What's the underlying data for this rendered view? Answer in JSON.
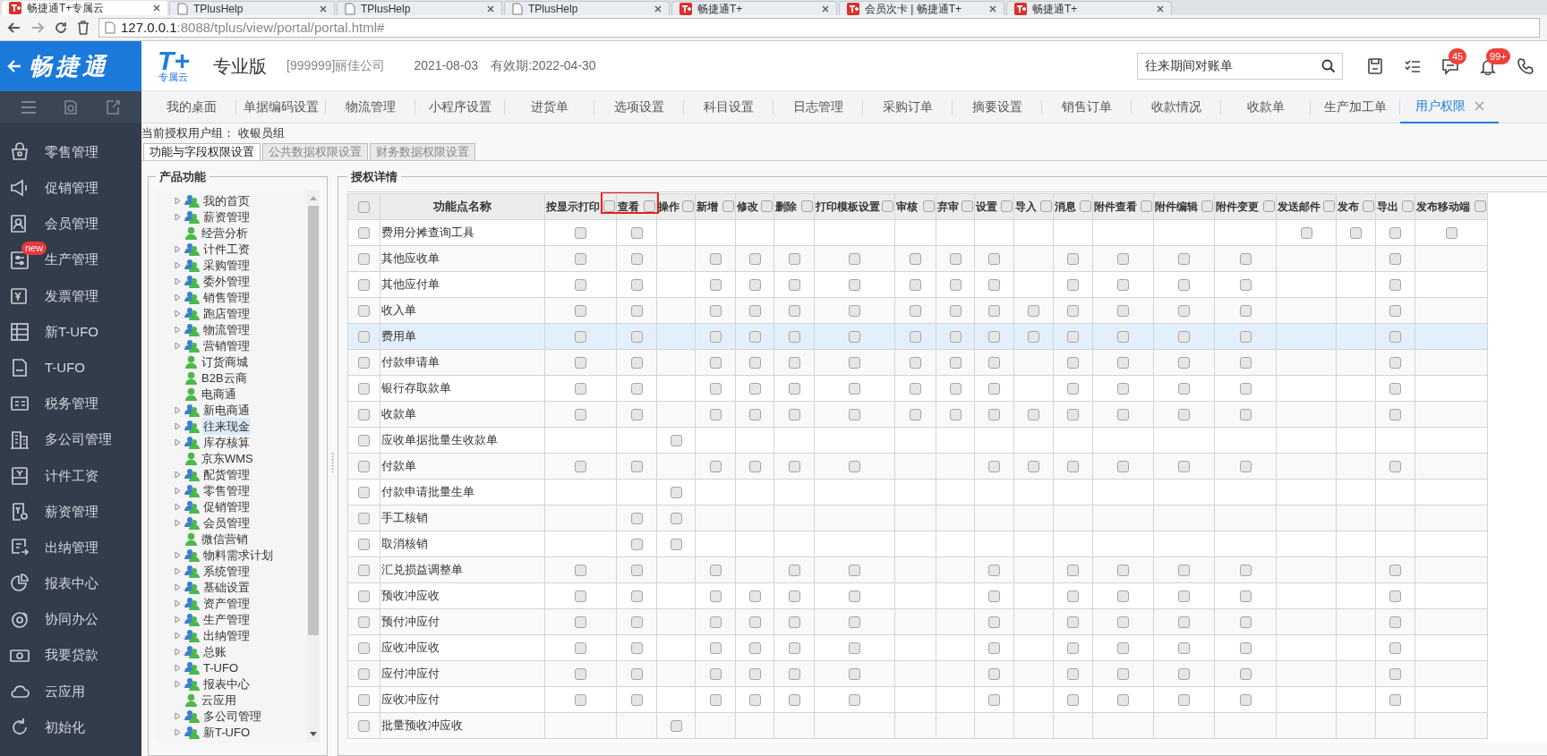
{
  "browser": {
    "tabs": [
      {
        "title": "畅捷通T+专属云",
        "kind": "app",
        "selected": true
      },
      {
        "title": "TPlusHelp",
        "kind": "doc",
        "selected": false
      },
      {
        "title": "TPlusHelp",
        "kind": "doc",
        "selected": false
      },
      {
        "title": "TPlusHelp",
        "kind": "doc",
        "selected": false
      },
      {
        "title": "畅捷通T+",
        "kind": "app",
        "selected": false
      },
      {
        "title": "会员次卡 | 畅捷通T+",
        "kind": "app",
        "selected": false
      },
      {
        "title": "畅捷通T+",
        "kind": "app",
        "selected": false
      }
    ],
    "address": {
      "host": "127.0.0.1",
      "path": ":8088/tplus/view/portal/portal.html#"
    }
  },
  "header": {
    "brand": "畅捷通",
    "logo": {
      "mark": "T+",
      "sub": "专属云"
    },
    "edition": "专业版",
    "company": "[999999]丽佳公司",
    "date": "2021-08-03",
    "validity": "有效期:2022-04-30",
    "search": {
      "value": "往来期间对账单"
    },
    "actions": [
      {
        "kind": "save"
      },
      {
        "kind": "checklist"
      },
      {
        "kind": "message",
        "badge": "45"
      },
      {
        "kind": "bell",
        "badge": "99+"
      },
      {
        "kind": "phone"
      }
    ]
  },
  "sidebar": {
    "items": [
      {
        "label": "零售管理"
      },
      {
        "label": "促销管理"
      },
      {
        "label": "会员管理"
      },
      {
        "label": "生产管理",
        "badge": "new"
      },
      {
        "label": "发票管理"
      },
      {
        "label": "新T-UFO"
      },
      {
        "label": "T-UFO"
      },
      {
        "label": "税务管理"
      },
      {
        "label": "多公司管理"
      },
      {
        "label": "计件工资"
      },
      {
        "label": "薪资管理"
      },
      {
        "label": "出纳管理"
      },
      {
        "label": "报表中心"
      },
      {
        "label": "协同办公"
      },
      {
        "label": "我要贷款"
      },
      {
        "label": "云应用"
      },
      {
        "label": "初始化"
      }
    ]
  },
  "nav_tabs": [
    {
      "label": "我的桌面",
      "selected": false
    },
    {
      "label": "单据编码设置",
      "selected": false
    },
    {
      "label": "物流管理",
      "selected": false
    },
    {
      "label": "小程序设置",
      "selected": false
    },
    {
      "label": "进货单",
      "selected": false
    },
    {
      "label": "选项设置",
      "selected": false
    },
    {
      "label": "科目设置",
      "selected": false
    },
    {
      "label": "日志管理",
      "selected": false
    },
    {
      "label": "采购订单",
      "selected": false
    },
    {
      "label": "摘要设置",
      "selected": false
    },
    {
      "label": "销售订单",
      "selected": false
    },
    {
      "label": "收款情况",
      "selected": false
    },
    {
      "label": "收款单",
      "selected": false
    },
    {
      "label": "生产加工单",
      "selected": false
    },
    {
      "label": "用户权限",
      "selected": true
    }
  ],
  "user_group": {
    "label": "当前授权用户组：",
    "value": "收银员组"
  },
  "sub_tabs": [
    {
      "label": "功能与字段权限设置",
      "selected": true
    },
    {
      "label": "公共数据权限设置",
      "selected": false
    },
    {
      "label": "财务数据权限设置",
      "selected": false
    }
  ],
  "product_panel": {
    "title": "产品功能",
    "tree": [
      {
        "label": "我的首页",
        "kind": "group",
        "selected": false
      },
      {
        "label": "薪资管理",
        "kind": "group",
        "selected": false
      },
      {
        "label": "经营分析",
        "kind": "leaf",
        "selected": false
      },
      {
        "label": "计件工资",
        "kind": "group",
        "selected": false
      },
      {
        "label": "采购管理",
        "kind": "group",
        "selected": false
      },
      {
        "label": "委外管理",
        "kind": "group",
        "selected": false
      },
      {
        "label": "销售管理",
        "kind": "group",
        "selected": false
      },
      {
        "label": "跑店管理",
        "kind": "group",
        "selected": false
      },
      {
        "label": "物流管理",
        "kind": "group",
        "selected": false
      },
      {
        "label": "营销管理",
        "kind": "group",
        "selected": false
      },
      {
        "label": "订货商城",
        "kind": "leaf",
        "selected": false
      },
      {
        "label": "B2B云商",
        "kind": "leaf",
        "selected": false
      },
      {
        "label": "电商通",
        "kind": "leaf",
        "selected": false
      },
      {
        "label": "新电商通",
        "kind": "group",
        "selected": false
      },
      {
        "label": "往来现金",
        "kind": "group",
        "selected": true
      },
      {
        "label": "库存核算",
        "kind": "group",
        "selected": false
      },
      {
        "label": "京东WMS",
        "kind": "leaf",
        "selected": false
      },
      {
        "label": "配货管理",
        "kind": "group",
        "selected": false
      },
      {
        "label": "零售管理",
        "kind": "group",
        "selected": false
      },
      {
        "label": "促销管理",
        "kind": "group",
        "selected": false
      },
      {
        "label": "会员管理",
        "kind": "group",
        "selected": false
      },
      {
        "label": "微信营销",
        "kind": "leaf",
        "selected": false
      },
      {
        "label": "物料需求计划",
        "kind": "group",
        "selected": false
      },
      {
        "label": "系统管理",
        "kind": "group",
        "selected": false
      },
      {
        "label": "基础设置",
        "kind": "group",
        "selected": false
      },
      {
        "label": "资产管理",
        "kind": "group",
        "selected": false
      },
      {
        "label": "生产管理",
        "kind": "group",
        "selected": false
      },
      {
        "label": "出纳管理",
        "kind": "group",
        "selected": false
      },
      {
        "label": "总账",
        "kind": "group",
        "selected": false
      },
      {
        "label": "T-UFO",
        "kind": "group",
        "selected": false
      },
      {
        "label": "报表中心",
        "kind": "group",
        "selected": false
      },
      {
        "label": "云应用",
        "kind": "leaf",
        "selected": false
      },
      {
        "label": "多公司管理",
        "kind": "group",
        "selected": false
      },
      {
        "label": "新T-UFO",
        "kind": "group",
        "selected": false
      }
    ]
  },
  "detail_panel": {
    "title": "授权详情",
    "table": {
      "select_all": {
        "checked": false
      },
      "name_column": "功能点名称",
      "columns": [
        {
          "label": "按显示打印",
          "checked": false,
          "framed": false
        },
        {
          "label": "查看",
          "checked": false,
          "framed": true
        },
        {
          "label": "操作",
          "checked": false,
          "framed": false
        },
        {
          "label": "新增",
          "checked": false,
          "framed": false
        },
        {
          "label": "修改",
          "checked": false,
          "framed": false
        },
        {
          "label": "删除",
          "checked": false,
          "framed": false
        },
        {
          "label": "打印模板设置",
          "checked": false,
          "framed": false
        },
        {
          "label": "审核",
          "checked": false,
          "framed": false
        },
        {
          "label": "弃审",
          "checked": false,
          "framed": false
        },
        {
          "label": "设置",
          "checked": false,
          "framed": false
        },
        {
          "label": "导入",
          "checked": false,
          "framed": false
        },
        {
          "label": "消息",
          "checked": false,
          "framed": false
        },
        {
          "label": "附件查看",
          "checked": false,
          "framed": false
        },
        {
          "label": "附件编辑",
          "checked": false,
          "framed": false
        },
        {
          "label": "附件变更",
          "checked": false,
          "framed": false
        },
        {
          "label": "发送邮件",
          "checked": false,
          "framed": false
        },
        {
          "label": "发布",
          "checked": false,
          "framed": false
        },
        {
          "label": "导出",
          "checked": false,
          "framed": false
        },
        {
          "label": "发布移动端",
          "checked": false,
          "framed": false
        }
      ],
      "rows": [
        {
          "name": "费用分摊查询工具",
          "checked": false,
          "selected": false,
          "cells": [
            false,
            false,
            null,
            null,
            null,
            null,
            null,
            null,
            null,
            null,
            null,
            null,
            null,
            null,
            null,
            false,
            false,
            false,
            false
          ]
        },
        {
          "name": "其他应收单",
          "checked": false,
          "selected": false,
          "cells": [
            false,
            false,
            null,
            false,
            false,
            false,
            false,
            false,
            false,
            false,
            null,
            false,
            false,
            false,
            false,
            null,
            null,
            false,
            null
          ]
        },
        {
          "name": "其他应付单",
          "checked": false,
          "selected": false,
          "cells": [
            false,
            false,
            null,
            false,
            false,
            false,
            false,
            false,
            false,
            false,
            null,
            false,
            false,
            false,
            false,
            null,
            null,
            false,
            null
          ]
        },
        {
          "name": "收入单",
          "checked": false,
          "selected": false,
          "cells": [
            false,
            false,
            null,
            false,
            false,
            false,
            false,
            false,
            false,
            false,
            false,
            false,
            false,
            false,
            false,
            null,
            null,
            false,
            null
          ]
        },
        {
          "name": "费用单",
          "checked": false,
          "selected": true,
          "cells": [
            false,
            false,
            null,
            false,
            false,
            false,
            false,
            false,
            false,
            false,
            false,
            false,
            false,
            false,
            false,
            null,
            null,
            false,
            null
          ]
        },
        {
          "name": "付款申请单",
          "checked": false,
          "selected": false,
          "cells": [
            false,
            false,
            null,
            false,
            false,
            false,
            false,
            false,
            false,
            false,
            null,
            false,
            false,
            false,
            false,
            null,
            null,
            false,
            null
          ]
        },
        {
          "name": "银行存取款单",
          "checked": false,
          "selected": false,
          "cells": [
            false,
            false,
            null,
            false,
            false,
            false,
            false,
            false,
            false,
            false,
            null,
            false,
            false,
            false,
            false,
            null,
            null,
            false,
            null
          ]
        },
        {
          "name": "收款单",
          "checked": false,
          "selected": false,
          "cells": [
            false,
            false,
            null,
            false,
            false,
            false,
            false,
            false,
            false,
            false,
            false,
            false,
            false,
            false,
            false,
            null,
            null,
            false,
            null
          ]
        },
        {
          "name": "应收单据批量生收款单",
          "checked": false,
          "selected": false,
          "cells": [
            null,
            null,
            false,
            null,
            null,
            null,
            null,
            null,
            null,
            null,
            null,
            null,
            null,
            null,
            null,
            null,
            null,
            null,
            null
          ]
        },
        {
          "name": "付款单",
          "checked": false,
          "selected": false,
          "cells": [
            false,
            false,
            null,
            false,
            false,
            false,
            false,
            null,
            null,
            false,
            false,
            false,
            false,
            false,
            false,
            null,
            null,
            false,
            null
          ]
        },
        {
          "name": "付款申请批量生单",
          "checked": false,
          "selected": false,
          "cells": [
            null,
            null,
            false,
            null,
            null,
            null,
            null,
            null,
            null,
            null,
            null,
            null,
            null,
            null,
            null,
            null,
            null,
            null,
            null
          ]
        },
        {
          "name": "手工核销",
          "checked": false,
          "selected": false,
          "cells": [
            null,
            false,
            false,
            null,
            null,
            null,
            null,
            null,
            null,
            null,
            null,
            null,
            null,
            null,
            null,
            null,
            null,
            null,
            null
          ]
        },
        {
          "name": "取消核销",
          "checked": false,
          "selected": false,
          "cells": [
            null,
            false,
            false,
            null,
            null,
            null,
            null,
            null,
            null,
            null,
            null,
            null,
            null,
            null,
            null,
            null,
            null,
            null,
            null
          ]
        },
        {
          "name": "汇兑损益调整单",
          "checked": false,
          "selected": false,
          "cells": [
            false,
            false,
            null,
            false,
            null,
            false,
            false,
            null,
            null,
            false,
            null,
            false,
            false,
            false,
            false,
            null,
            null,
            false,
            null
          ]
        },
        {
          "name": "预收冲应收",
          "checked": false,
          "selected": false,
          "cells": [
            false,
            false,
            null,
            false,
            false,
            false,
            false,
            null,
            null,
            false,
            null,
            false,
            false,
            false,
            false,
            null,
            null,
            false,
            null
          ]
        },
        {
          "name": "预付冲应付",
          "checked": false,
          "selected": false,
          "cells": [
            false,
            false,
            null,
            false,
            false,
            false,
            false,
            null,
            null,
            false,
            null,
            false,
            false,
            false,
            false,
            null,
            null,
            false,
            null
          ]
        },
        {
          "name": "应收冲应收",
          "checked": false,
          "selected": false,
          "cells": [
            false,
            false,
            null,
            false,
            false,
            false,
            false,
            null,
            null,
            false,
            null,
            false,
            false,
            false,
            false,
            null,
            null,
            false,
            null
          ]
        },
        {
          "name": "应付冲应付",
          "checked": false,
          "selected": false,
          "cells": [
            false,
            false,
            null,
            false,
            false,
            false,
            false,
            null,
            null,
            false,
            null,
            false,
            false,
            false,
            false,
            null,
            null,
            false,
            null
          ]
        },
        {
          "name": "应收冲应付",
          "checked": false,
          "selected": false,
          "cells": [
            false,
            false,
            null,
            false,
            false,
            false,
            false,
            null,
            null,
            false,
            null,
            false,
            false,
            false,
            false,
            null,
            null,
            false,
            null
          ]
        },
        {
          "name": "批量预收冲应收",
          "checked": false,
          "selected": false,
          "cells": [
            null,
            null,
            false,
            null,
            null,
            null,
            null,
            null,
            null,
            null,
            null,
            null,
            null,
            null,
            null,
            null,
            null,
            null,
            null
          ]
        }
      ]
    }
  }
}
